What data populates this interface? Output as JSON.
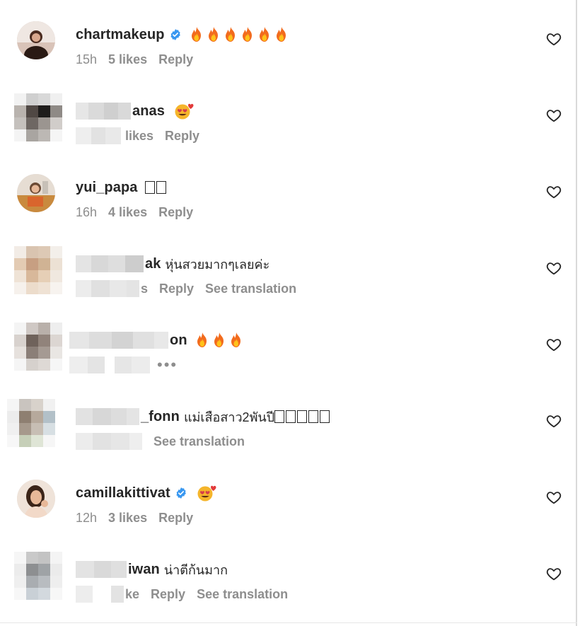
{
  "comments": [
    {
      "username": "chartmakeup",
      "verified": true,
      "text": "",
      "emoji": [
        "fire-emoji",
        "fire-emoji",
        "fire-emoji",
        "fire-emoji",
        "fire-emoji",
        "fire-emoji"
      ],
      "time": "15h",
      "likes": "5 likes",
      "reply": "Reply"
    },
    {
      "username_visible": "anas",
      "username_blurred": true,
      "text": "",
      "emoji": [
        "heart-eyes-emoji"
      ],
      "time": "",
      "likes": "likes",
      "reply": "Reply"
    },
    {
      "username": "yui_papa",
      "text": "",
      "box_glyphs": 2,
      "time": "16h",
      "likes": "4 likes",
      "reply": "Reply"
    },
    {
      "username_visible": "ak",
      "username_blurred": true,
      "text": "หุ่นสวยมากๆเลยค่ะ",
      "time": "",
      "likes": "s",
      "reply": "Reply",
      "translation": "See translation"
    },
    {
      "username_visible": "on",
      "username_blurred": true,
      "text": "",
      "emoji": [
        "fire-emoji",
        "fire-emoji",
        "fire-emoji"
      ],
      "more": "•••"
    },
    {
      "username_visible": "_fonn",
      "username_blurred": true,
      "text": "แม่เสือสาว2พันปี",
      "box_glyphs": 5,
      "translation": "See translation"
    },
    {
      "username": "camillakittivat",
      "verified": true,
      "emoji": [
        "heart-eyes-emoji"
      ],
      "time": "12h",
      "likes": "3 likes",
      "reply": "Reply"
    },
    {
      "username_visible": "iwan",
      "username_blurred": true,
      "text": "น่าตีก้นมาก",
      "likes": "ke",
      "reply": "Reply",
      "translation": "See translation"
    }
  ],
  "icons": {
    "like": "heart-outline-icon",
    "verified": "verified-badge-icon"
  },
  "colors": {
    "text": "#262626",
    "meta": "#8e8e8e",
    "verified": "#3897f0",
    "divider": "#d9d9d9"
  }
}
